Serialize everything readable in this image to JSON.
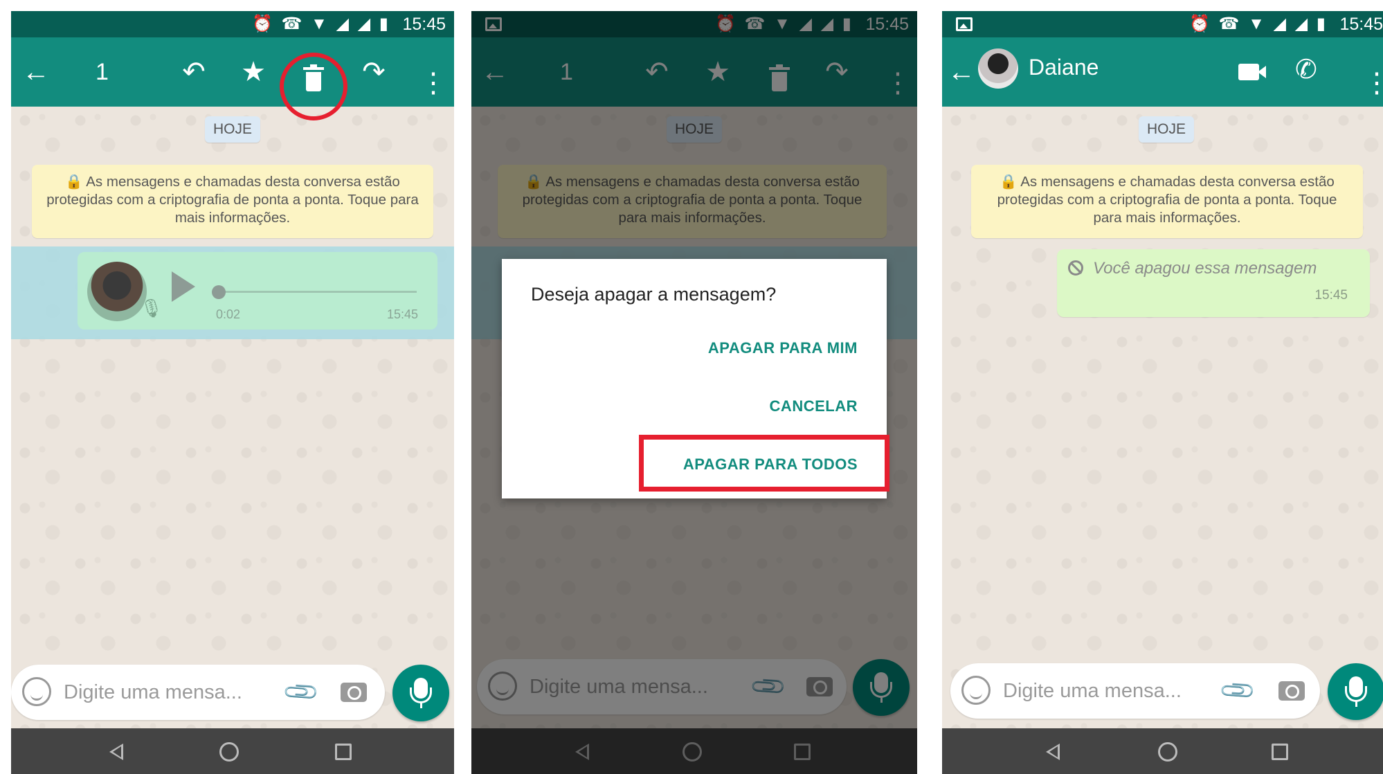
{
  "status": {
    "time": "15:45"
  },
  "chat": {
    "date_chip": "HOJE",
    "encryption_note": "🔒 As mensagens e chamadas desta conversa estão protegidas com a criptografia de ponta a ponta. Toque para mais informações.",
    "input_placeholder": "Digite uma mensa..."
  },
  "screen1": {
    "selected_count": "1",
    "voice_message": {
      "duration": "0:02",
      "time": "15:45",
      "progress": 0
    }
  },
  "screen2": {
    "selected_count": "1",
    "dialog": {
      "title": "Deseja apagar a mensagem?",
      "delete_for_me": "APAGAR PARA MIM",
      "cancel": "CANCELAR",
      "delete_for_all": "APAGAR PARA TODOS"
    }
  },
  "screen3": {
    "contact_name": "Daiane",
    "deleted_message": "Você apagou essa mensagem",
    "deleted_time": "15:45"
  },
  "icons": {
    "back": "arrow-left-icon",
    "reply": "reply-icon",
    "star": "star-icon",
    "delete": "trash-icon",
    "forward": "forward-icon",
    "more": "more-vertical-icon",
    "video": "video-call-icon",
    "call": "phone-icon",
    "mic": "microphone-icon"
  },
  "colors": {
    "header": "#128c7e",
    "statusbar": "#075e54",
    "highlight": "#e61f2f",
    "accent": "#00897b"
  }
}
